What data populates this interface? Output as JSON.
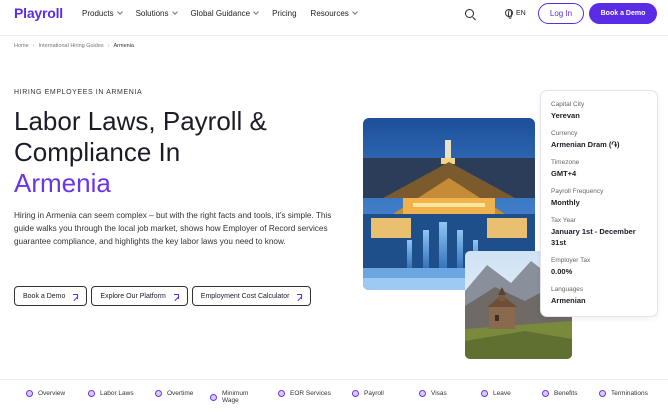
{
  "brand": {
    "logo": "Playroll",
    "accent": "#5b2ce6"
  },
  "nav": {
    "items": [
      {
        "label": "Products",
        "dropdown": true
      },
      {
        "label": "Solutions",
        "dropdown": true
      },
      {
        "label": "Global Guidance",
        "dropdown": true
      },
      {
        "label": "Pricing",
        "dropdown": false
      },
      {
        "label": "Resources",
        "dropdown": true
      }
    ],
    "language": "EN",
    "login_label": "Log In",
    "demo_label": "Book a Demo"
  },
  "breadcrumb": [
    "Home",
    "International Hiring Guides",
    "Armenia"
  ],
  "hero": {
    "eyebrow": "HIRING EMPLOYEES IN ARMENIA",
    "title_line1": "Labor Laws, Payroll &",
    "title_line2": "Compliance In",
    "title_accent": "Armenia",
    "description": "Hiring in Armenia can seem complex – but with the right facts and tools, it’s simple. This guide walks you through the local job market, shows how Employer of Record services guarantee compliance, and highlights the key labor laws you need to know.",
    "buttons": [
      "Book a Demo",
      "Explore Our Platform",
      "Employment Cost Calculator"
    ]
  },
  "facts": [
    {
      "label": "Capital City",
      "value": "Yerevan"
    },
    {
      "label": "Currency",
      "value": "Armenian Dram (֏)"
    },
    {
      "label": "Timezone",
      "value": "GMT+4"
    },
    {
      "label": "Payroll Frequency",
      "value": "Monthly"
    },
    {
      "label": "Tax Year",
      "value": "January 1st - December 31st"
    },
    {
      "label": "Employer Tax",
      "value": "0.00%"
    },
    {
      "label": "Languages",
      "value": "Armenian"
    }
  ],
  "tabs": [
    "Overview",
    "Labor Laws",
    "Overtime",
    "Minimum Wage",
    "EOR Services",
    "Payroll",
    "Visas",
    "Leave",
    "Benefits",
    "Terminations"
  ]
}
